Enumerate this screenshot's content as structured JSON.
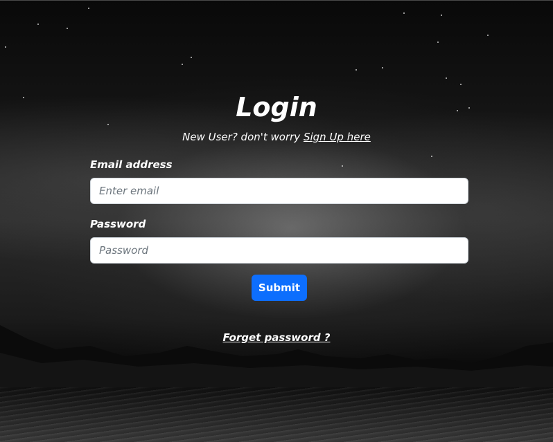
{
  "page": {
    "title": "Login",
    "subtitle_text": "New User? don't worry ",
    "signup_link": "Sign Up here"
  },
  "form": {
    "email_label": "Email address",
    "email_placeholder": "Enter email",
    "email_value": "",
    "password_label": "Password",
    "password_placeholder": "Password",
    "password_value": "",
    "submit_label": "Submit"
  },
  "footer": {
    "forgot_link": "Forget password ?"
  },
  "colors": {
    "accent": "#0d6efd",
    "text": "#ffffff",
    "input_bg": "#ffffff"
  }
}
